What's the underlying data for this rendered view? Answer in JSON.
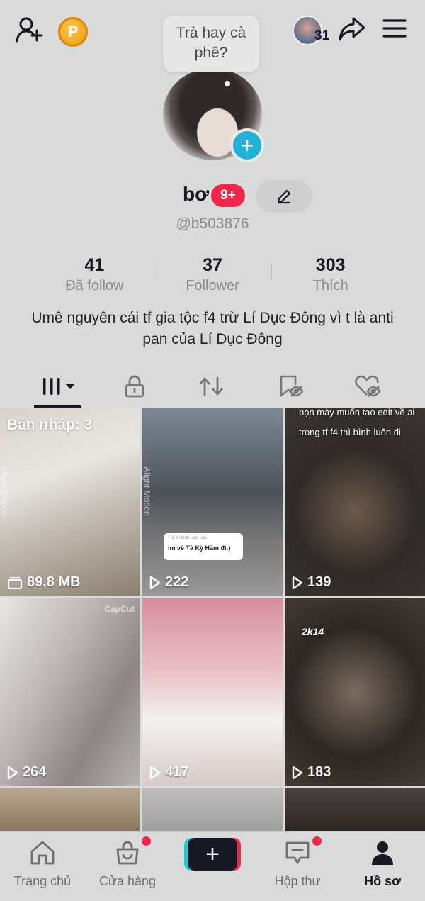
{
  "header": {
    "coin_label": "P",
    "friends_count": "31",
    "bubble_text": "Trà hay cà phê?"
  },
  "profile": {
    "username": "bơ",
    "notification_badge": "9+",
    "handle": "@b503876",
    "stats": [
      {
        "value": "41",
        "label": "Đã follow"
      },
      {
        "value": "37",
        "label": "Follower"
      },
      {
        "value": "303",
        "label": "Thích"
      }
    ],
    "bio": "Umê nguyên cái tf gia tộc f4 trừ Lí Dục Đông vì t là anti pan của Lí Dục Đông"
  },
  "tabs": [
    {
      "icon": "grid-icon",
      "active": true
    },
    {
      "icon": "lock-icon",
      "active": false
    },
    {
      "icon": "repost-icon",
      "active": false
    },
    {
      "icon": "bookmark-eye-icon",
      "active": false
    },
    {
      "icon": "heart-eye-icon",
      "active": false
    }
  ],
  "videos": [
    {
      "top_label": "Bản nháp: 3",
      "watermark": "Alight Motion",
      "stat": "89,8 MB",
      "stat_icon": "folder-icon"
    },
    {
      "watermark": "Alight Motion",
      "sticker_title": "Trả lời bình luận của",
      "sticker_text": "im về Tả Kỳ Hàm đi:)",
      "stat": "222",
      "stat_icon": "play-icon"
    },
    {
      "caption": "bọn mày muốn tao edit về ai trong tf f4 thì bình luôn đi",
      "stat": "139",
      "stat_icon": "play-icon"
    },
    {
      "watermark": "CapCut",
      "stat": "264",
      "stat_icon": "play-icon"
    },
    {
      "stat": "417",
      "stat_icon": "play-icon"
    },
    {
      "caption": "2k14",
      "stat": "183",
      "stat_icon": "play-icon"
    }
  ],
  "bottom_nav": [
    {
      "label": "Trang chủ",
      "icon": "home-icon",
      "dot": false,
      "active": false
    },
    {
      "label": "Cửa hàng",
      "icon": "shop-bag-icon",
      "dot": true,
      "active": false
    },
    {
      "label": "",
      "icon": "plus-icon",
      "dot": false,
      "active": false
    },
    {
      "label": "Hộp thư",
      "icon": "inbox-icon",
      "dot": true,
      "active": false
    },
    {
      "label": "Hồ sơ",
      "icon": "profile-icon",
      "dot": false,
      "active": true
    }
  ],
  "colors": {
    "background": "#dadada",
    "badge_red": "#f0274a",
    "plus_blue": "#20b0d8",
    "coin_gold": "#f5a623",
    "text_primary": "#161823",
    "text_secondary": "#8a8a8a"
  }
}
